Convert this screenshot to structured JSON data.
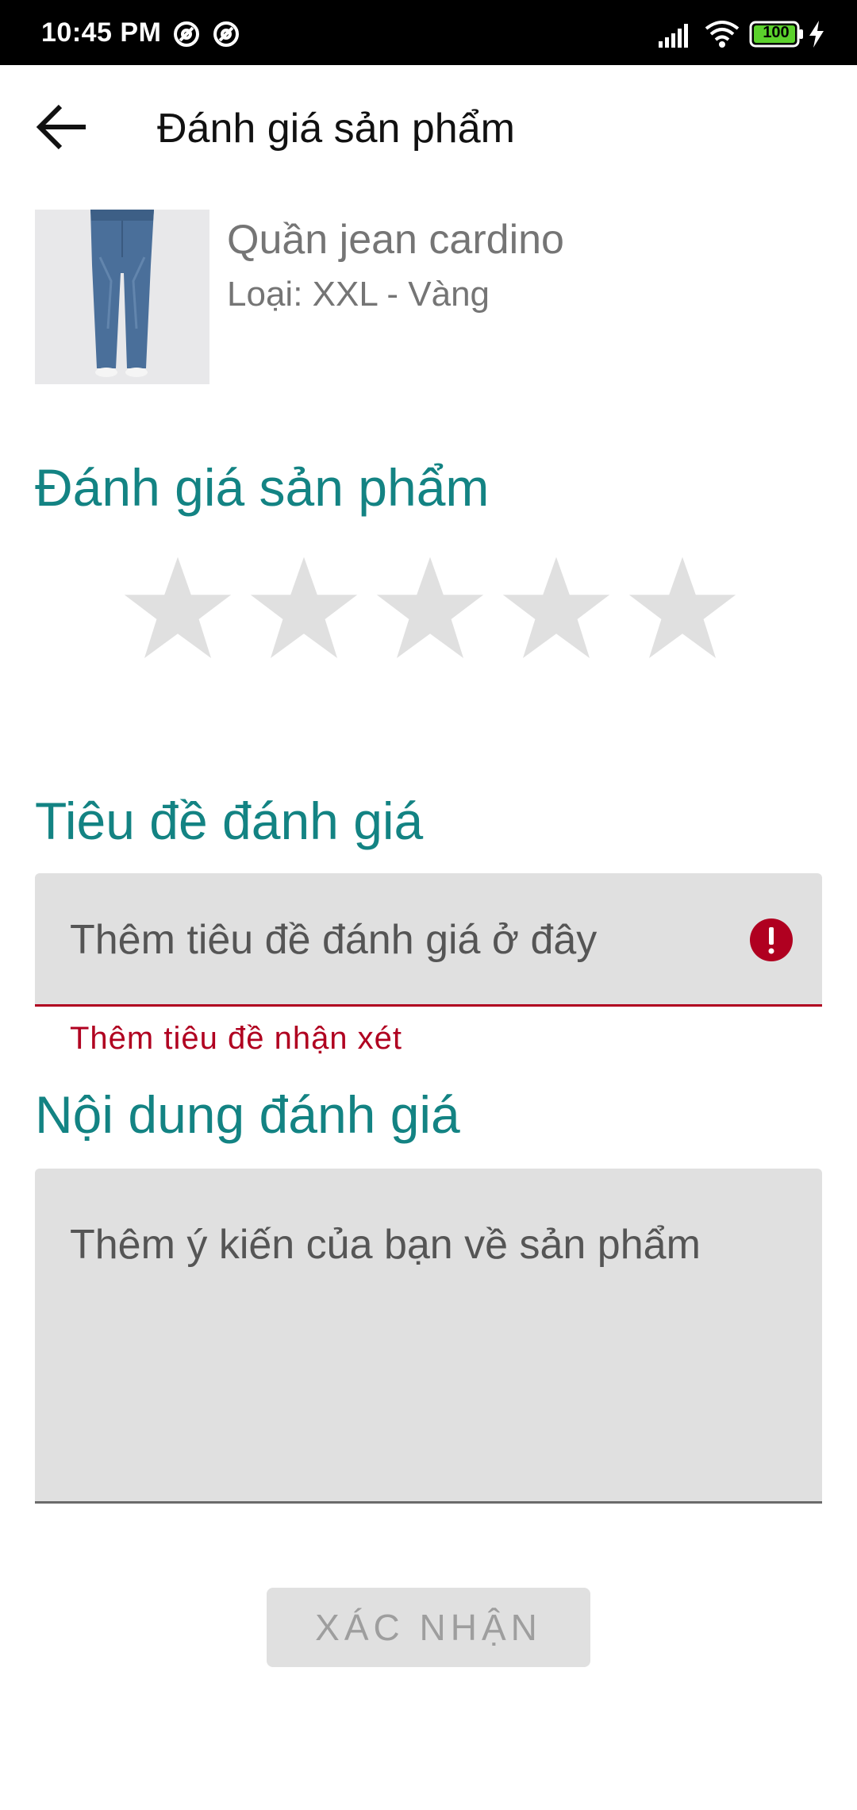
{
  "status_bar": {
    "time": "10:45 PM",
    "battery": "100",
    "icons": [
      "at-sign-icon",
      "at-sign-icon",
      "signal-icon",
      "wifi-icon",
      "battery-icon",
      "charging-icon"
    ]
  },
  "app_bar": {
    "back_icon": "arrow-left-icon",
    "title": "Đánh giá sản phẩm"
  },
  "product": {
    "name": "Quần jean cardino",
    "variant": "Loại: XXL - Vàng",
    "image_icon": "jeans-image"
  },
  "rating": {
    "title": "Đánh giá sản phẩm",
    "max_stars": 5,
    "selected_stars": 0
  },
  "review_title": {
    "label": "Tiêu đề đánh giá",
    "placeholder": "Thêm tiêu đề đánh giá ở đây",
    "value": "",
    "error": "Thêm tiêu đề nhận xét"
  },
  "review_content": {
    "label": "Nội dung đánh giá",
    "placeholder": "Thêm ý kiến của bạn về sản phẩm",
    "value": ""
  },
  "submit": {
    "label": "XÁC NHẬN"
  },
  "colors": {
    "accent": "#138383",
    "error": "#b00020",
    "star_empty": "#e0e0e0",
    "field_bg": "#e0e0e0"
  }
}
